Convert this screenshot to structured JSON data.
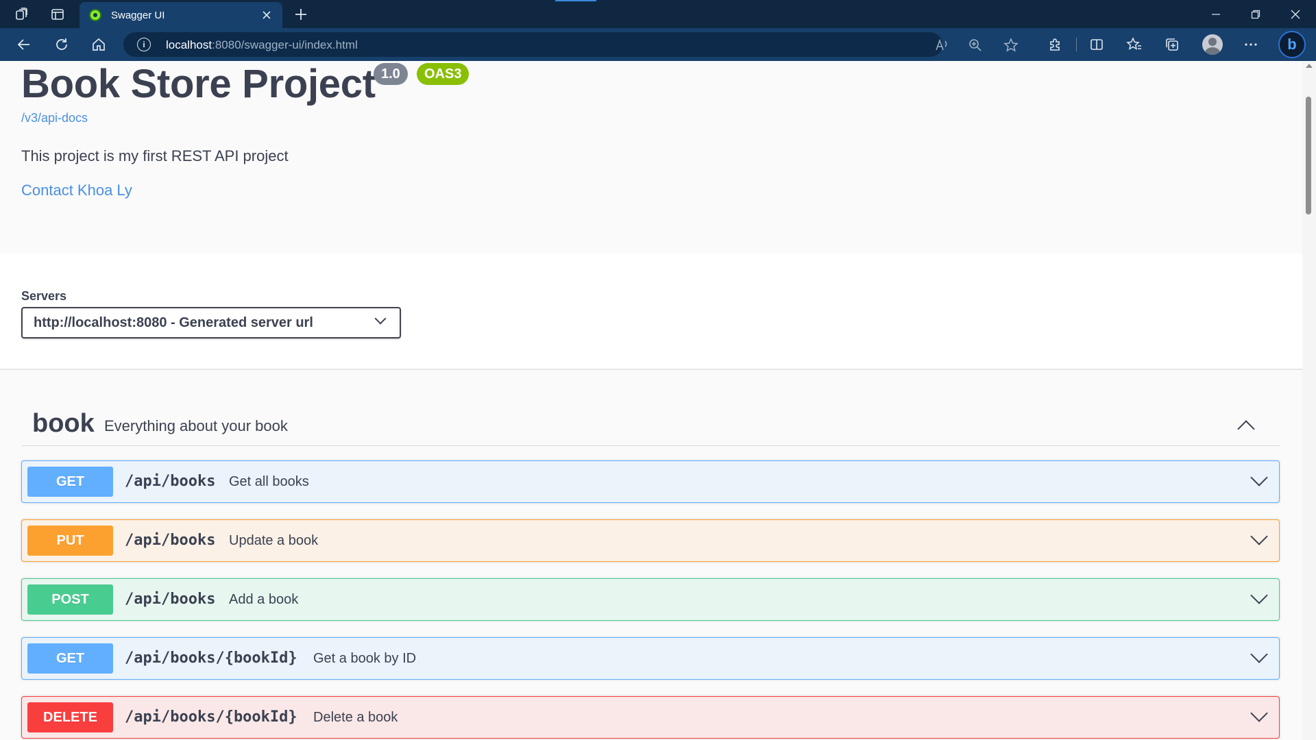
{
  "browser": {
    "tab_title": "Swagger UI",
    "url_host": "localhost",
    "url_rest": ":8080/swagger-ui/index.html"
  },
  "info": {
    "title": "Book Store Project",
    "version_badge": "1.0",
    "oas_badge": "OAS3",
    "spec_link": "/v3/api-docs",
    "description": "This project is my first REST API project",
    "contact": "Contact Khoa Ly"
  },
  "servers": {
    "label": "Servers",
    "selected": "http://localhost:8080 - Generated server url"
  },
  "tag": {
    "name": "book",
    "description": "Everything about your book",
    "operations": [
      {
        "method": "GET",
        "path": "/api/books",
        "summary": "Get all books"
      },
      {
        "method": "PUT",
        "path": "/api/books",
        "summary": "Update a book"
      },
      {
        "method": "POST",
        "path": "/api/books",
        "summary": "Add a book"
      },
      {
        "method": "GET",
        "path": "/api/books/{bookId}",
        "summary": "Get a book by ID"
      },
      {
        "method": "DELETE",
        "path": "/api/books/{bookId}",
        "summary": "Delete a book"
      }
    ]
  },
  "colors": {
    "get": "#61affe",
    "put": "#fca130",
    "post": "#49cc90",
    "delete": "#f93e3e",
    "link": "#4990e2",
    "oas_badge": "#89bf04"
  }
}
